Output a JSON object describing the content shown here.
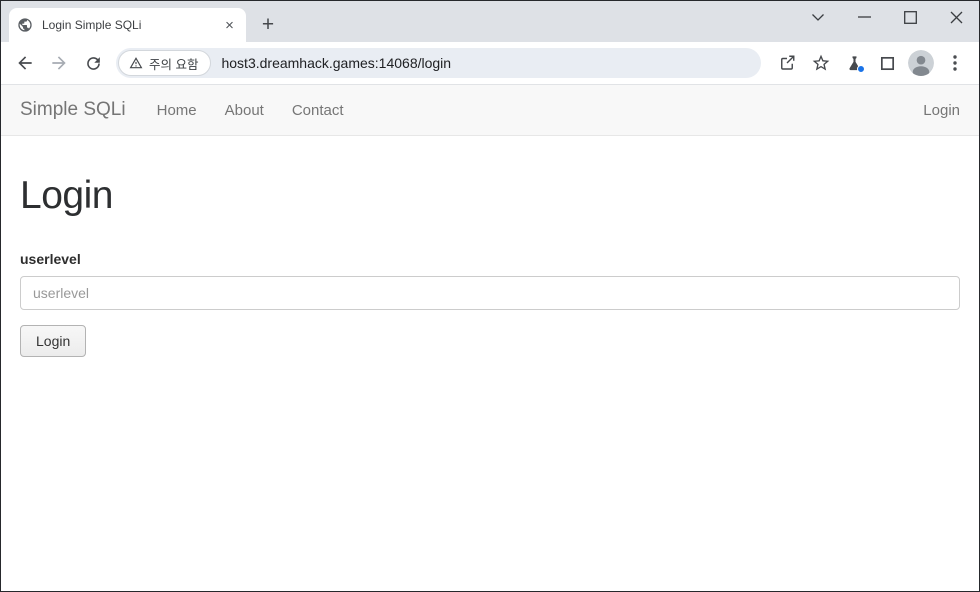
{
  "browser": {
    "tab_title": "Login Simple SQLi",
    "tab_close_glyph": "×",
    "new_tab_glyph": "+",
    "security_chip_label": "주의 요함",
    "url": "host3.dreamhack.games:14068/login"
  },
  "navbar": {
    "brand": "Simple SQLi",
    "links": [
      {
        "label": "Home"
      },
      {
        "label": "About"
      },
      {
        "label": "Contact"
      }
    ],
    "login_label": "Login"
  },
  "main": {
    "heading": "Login",
    "form": {
      "label": "userlevel",
      "input_placeholder": "userlevel",
      "input_value": "",
      "submit_label": "Login"
    }
  },
  "icons": {
    "favicon": "globe-icon",
    "omnibox_left": "warning-triangle-icon",
    "toolbar_left": [
      "back-arrow-icon",
      "forward-arrow-icon",
      "reload-icon"
    ],
    "toolbar_right": [
      "share-icon",
      "star-icon",
      "beaker-icon",
      "side-panel-icon",
      "profile-avatar",
      "kebab-menu-icon"
    ],
    "window_controls": [
      "tab-search-chevron-icon",
      "minimize-icon",
      "maximize-icon",
      "close-icon"
    ]
  },
  "colors": {
    "titlebar_bg": "#dee1e6",
    "window_border": "#26282c",
    "omnibox_bg": "#e9edf3",
    "extension_badge_blue": "#1a73e8",
    "navbar_bg": "#f8f8f8",
    "navbar_border": "#e7e7e7",
    "navbar_text": "#767676",
    "heading_text": "#2d2f31",
    "placeholder_text": "#999999",
    "icon_gray": "#46494d"
  }
}
